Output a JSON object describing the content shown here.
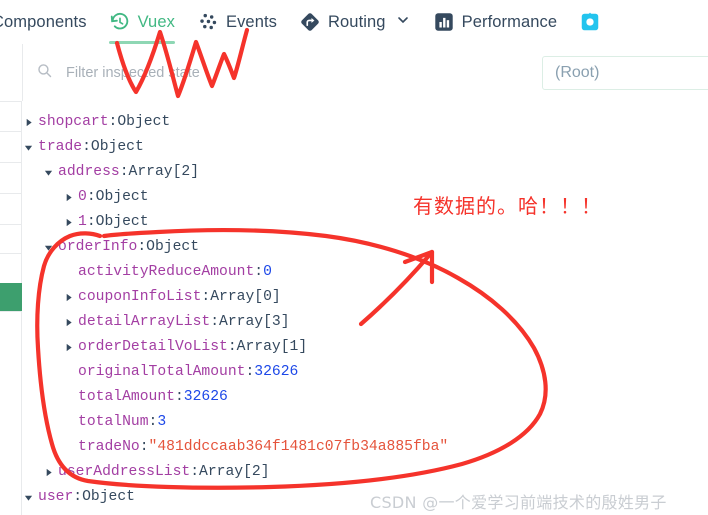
{
  "tabs": [
    {
      "label": "Components",
      "icon": "components-icon",
      "active": false,
      "chevron": false
    },
    {
      "label": "Vuex",
      "icon": "vuex-history-icon",
      "active": true,
      "chevron": false
    },
    {
      "label": "Events",
      "icon": "events-dots-icon",
      "active": false,
      "chevron": false
    },
    {
      "label": "Routing",
      "icon": "routing-diamond-icon",
      "active": false,
      "chevron": true
    },
    {
      "label": "Performance",
      "icon": "performance-bars-icon",
      "active": false,
      "chevron": false
    },
    {
      "label": "",
      "icon": "settings-gear-icon",
      "active": false,
      "chevron": false
    }
  ],
  "toolbar": {
    "search_icon": "search-icon",
    "filter_placeholder": "Filter inspected state",
    "filter_value": "",
    "root_selector_value": "(Root)"
  },
  "tree": [
    {
      "indent": 0,
      "arrow": "collapsed",
      "key": "shopcart",
      "value": "Object",
      "vtype": "type"
    },
    {
      "indent": 0,
      "arrow": "expanded",
      "key": "trade",
      "value": "Object",
      "vtype": "type"
    },
    {
      "indent": 1,
      "arrow": "expanded",
      "key": "address",
      "value": "Array[2]",
      "vtype": "type"
    },
    {
      "indent": 2,
      "arrow": "collapsed",
      "key": "0",
      "value": "Object",
      "vtype": "type"
    },
    {
      "indent": 2,
      "arrow": "collapsed",
      "key": "1",
      "value": "Object",
      "vtype": "type"
    },
    {
      "indent": 1,
      "arrow": "expanded",
      "key": "orderInfo",
      "value": "Object",
      "vtype": "type"
    },
    {
      "indent": 2,
      "arrow": "none",
      "key": "activityReduceAmount",
      "value": "0",
      "vtype": "number"
    },
    {
      "indent": 2,
      "arrow": "collapsed",
      "key": "couponInfoList",
      "value": "Array[0]",
      "vtype": "type"
    },
    {
      "indent": 2,
      "arrow": "collapsed",
      "key": "detailArrayList",
      "value": "Array[3]",
      "vtype": "type"
    },
    {
      "indent": 2,
      "arrow": "collapsed",
      "key": "orderDetailVoList",
      "value": "Array[1]",
      "vtype": "type"
    },
    {
      "indent": 2,
      "arrow": "none",
      "key": "originalTotalAmount",
      "value": "32626",
      "vtype": "number"
    },
    {
      "indent": 2,
      "arrow": "none",
      "key": "totalAmount",
      "value": "32626",
      "vtype": "number"
    },
    {
      "indent": 2,
      "arrow": "none",
      "key": "totalNum",
      "value": "3",
      "vtype": "number"
    },
    {
      "indent": 2,
      "arrow": "none",
      "key": "tradeNo",
      "value": "\"481ddccaab364f1481c07fb34a885fba\"",
      "vtype": "string"
    },
    {
      "indent": 1,
      "arrow": "collapsed",
      "key": "userAddressList",
      "value": "Array[2]",
      "vtype": "type"
    },
    {
      "indent": 0,
      "arrow": "expanded",
      "key": "user",
      "value": "Object",
      "vtype": "type"
    }
  ],
  "annotation": {
    "note_text": "有数据的。哈！！！",
    "color": "#f5332b"
  },
  "watermark": {
    "text": "CSDN @一个爱学习前端技术的殷姓男子"
  },
  "colors": {
    "accent_green": "#41b883",
    "tab_text": "#35495e",
    "key_purple": "#a33ea3",
    "number_blue": "#1d48e8",
    "string_red": "#e5543c",
    "rail_active_green": "#3d9f6e"
  }
}
